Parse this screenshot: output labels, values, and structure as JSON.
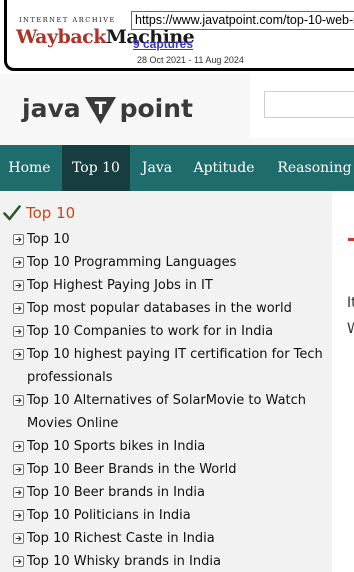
{
  "wayback": {
    "logo_top": "INTERNET ARCHIVE",
    "logo_word_1": "Wayback",
    "logo_word_2": "Machine",
    "url": "https://www.javatpoint.com/top-10-web-se",
    "captures": "9 captures",
    "dates": "28 Oct 2021 - 11 Aug 2024"
  },
  "brand": {
    "left": "java",
    "letter": "T",
    "right": "point"
  },
  "colors": {
    "nav_bg": "#1f6c6c",
    "nav_active": "#163d3f",
    "sidebar_title": "#c4481e",
    "sidebar_bg": "#f2f2f2"
  },
  "nav": [
    {
      "label": "Home",
      "active": false
    },
    {
      "label": "Top 10",
      "active": true
    },
    {
      "label": "Java",
      "active": false
    },
    {
      "label": "Aptitude",
      "active": false
    },
    {
      "label": "Reasoning",
      "active": false
    }
  ],
  "sidebar": {
    "title": "Top 10",
    "title_icon": "check-icon",
    "item_icon": "arrow-box-icon",
    "items": [
      "Top 10",
      "Top 10 Programming Languages",
      "Top Highest Paying Jobs in IT",
      "Top most popular databases in the world",
      "Top 10 Companies to work for in India",
      "Top 10 highest paying IT certification for Tech professionals",
      "Top 10 Alternatives of SolarMovie to Watch Movies Online",
      "Top 10 Sports bikes in India",
      "Top 10 Beer Brands in the World",
      "Top 10 Beer brands in India",
      "Top 10 Politicians in India",
      "Top 10 Richest Caste in India",
      "Top 10 Whisky brands in India"
    ]
  },
  "content": {
    "fragment_1": "It",
    "fragment_2": "W"
  }
}
